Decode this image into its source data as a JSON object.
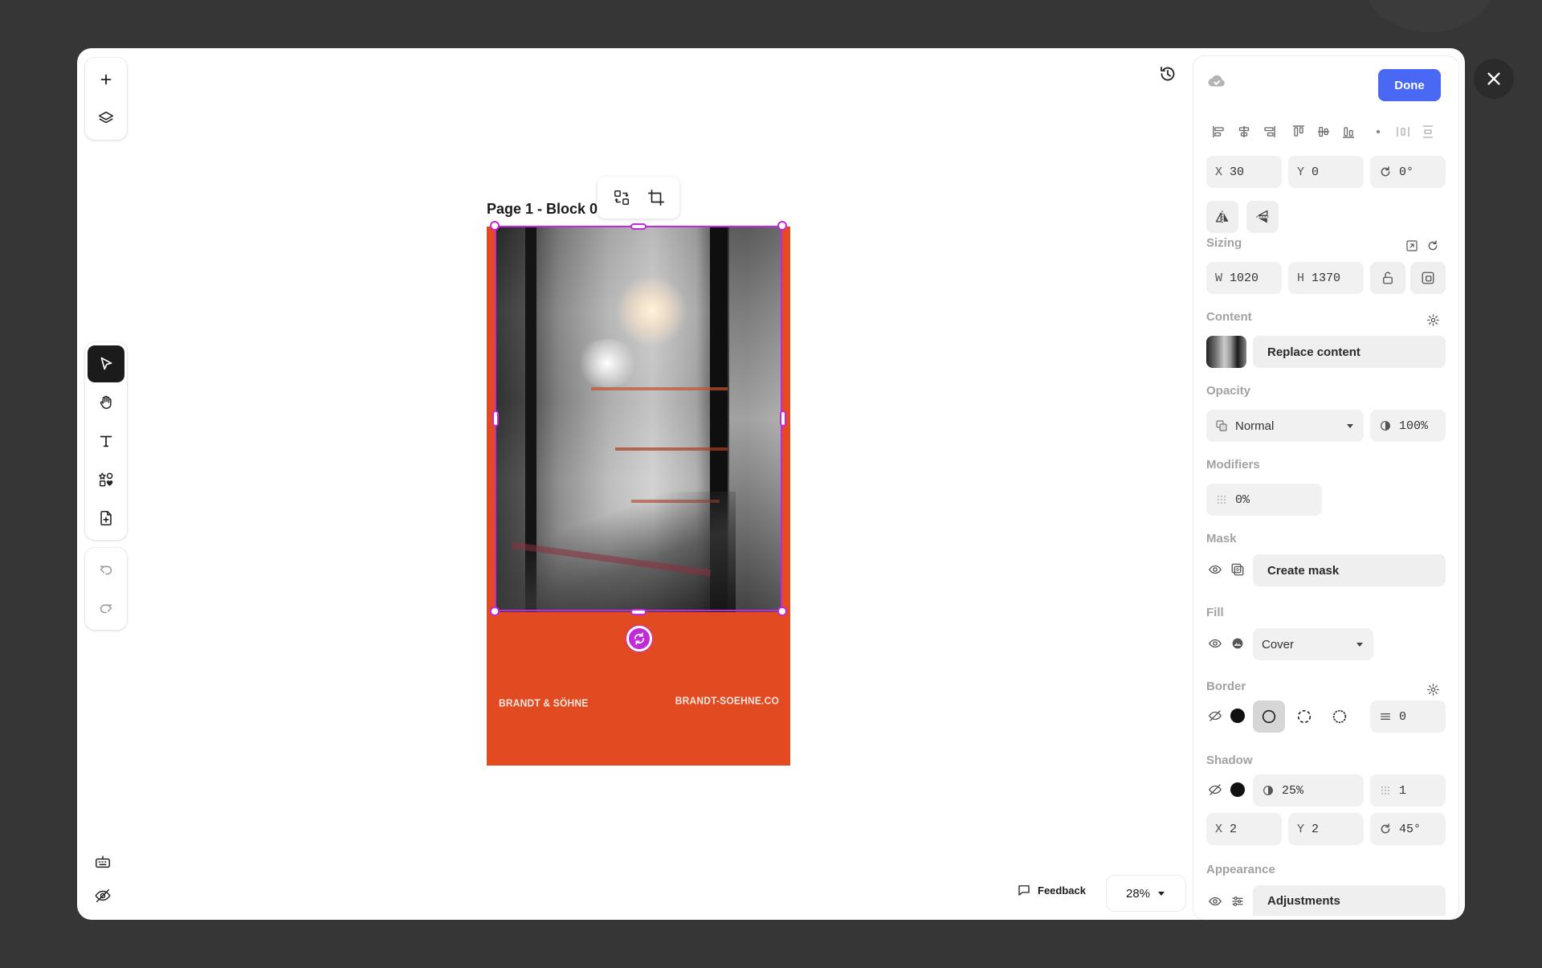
{
  "canvas": {
    "block_label": "Page 1 - Block 0...",
    "brand_left": "BRANDT & SÖHNE",
    "brand_right": "BRANDT-SOEHNE.CO",
    "page_color": "#e24a22",
    "selection_color": "#c12ad8"
  },
  "footer": {
    "feedback_label": "Feedback",
    "zoom_value": "28%"
  },
  "left_toolbar": {
    "top": [
      "plus-icon",
      "layers-icon"
    ],
    "tools": [
      "pointer-icon",
      "hand-icon",
      "text-icon",
      "shapes-icon",
      "add-page-icon"
    ],
    "history": [
      "undo-icon",
      "redo-icon"
    ],
    "bottom": [
      "keyboard-icon",
      "hide-icon"
    ]
  },
  "panel": {
    "done_label": "Done",
    "position": {
      "x_label": "X",
      "x_value": "30",
      "y_label": "Y",
      "y_value": "0",
      "rotation_value": "0°"
    },
    "sizing": {
      "title": "Sizing",
      "w_label": "W",
      "w_value": "1020",
      "h_label": "H",
      "h_value": "1370"
    },
    "content": {
      "title": "Content",
      "replace_label": "Replace content"
    },
    "opacity": {
      "title": "Opacity",
      "blend_mode": "Normal",
      "value": "100%"
    },
    "modifiers": {
      "title": "Modifiers",
      "blur_value": "0%"
    },
    "mask": {
      "title": "Mask",
      "create_label": "Create mask"
    },
    "fill": {
      "title": "Fill",
      "mode": "Cover"
    },
    "border": {
      "title": "Border",
      "width_value": "0"
    },
    "shadow": {
      "title": "Shadow",
      "opacity_value": "25%",
      "blur_value": "1",
      "x_label": "X",
      "x_value": "2",
      "y_label": "Y",
      "y_value": "2",
      "angle_value": "45°"
    },
    "appearance": {
      "title": "Appearance",
      "adjustments_label": "Adjustments"
    },
    "accent_color": "#4968f3"
  }
}
